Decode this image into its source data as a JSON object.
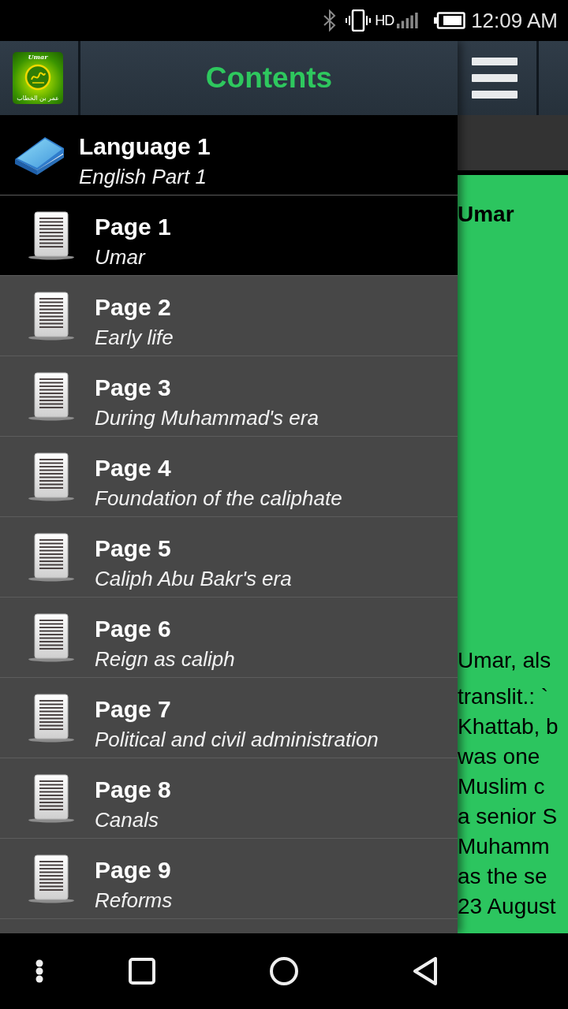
{
  "status_bar": {
    "network_label": "HD",
    "time": "12:09 AM"
  },
  "drawer": {
    "logo": {
      "caption": "Umar",
      "arabic_caption": "عمر بن الخطاب"
    },
    "title": "Contents",
    "sections": [
      {
        "title": "Language 1",
        "subtitle": "English Part 1",
        "items": [
          {
            "title": "Page 1",
            "subtitle": "Umar",
            "selected": true
          },
          {
            "title": "Page 2",
            "subtitle": "Early life",
            "selected": false
          },
          {
            "title": "Page 3",
            "subtitle": "During Muhammad's era",
            "selected": false
          },
          {
            "title": "Page 4",
            "subtitle": "Foundation of the caliphate",
            "selected": false
          },
          {
            "title": "Page 5",
            "subtitle": "Caliph Abu Bakr's era",
            "selected": false
          },
          {
            "title": "Page 6",
            "subtitle": "Reign as caliph",
            "selected": false
          },
          {
            "title": "Page 7",
            "subtitle": "Political and civil administration",
            "selected": false
          },
          {
            "title": "Page 8",
            "subtitle": "Canals",
            "selected": false
          },
          {
            "title": "Page 9",
            "subtitle": "Reforms",
            "selected": false
          }
        ]
      }
    ]
  },
  "article": {
    "heading": "Umar",
    "lines": [
      "Umar, als",
      "translit.: `",
      "Khattab, b",
      "was one",
      "Muslim c",
      "a senior S",
      "Muhamm",
      "as the se",
      "23 August"
    ]
  }
}
